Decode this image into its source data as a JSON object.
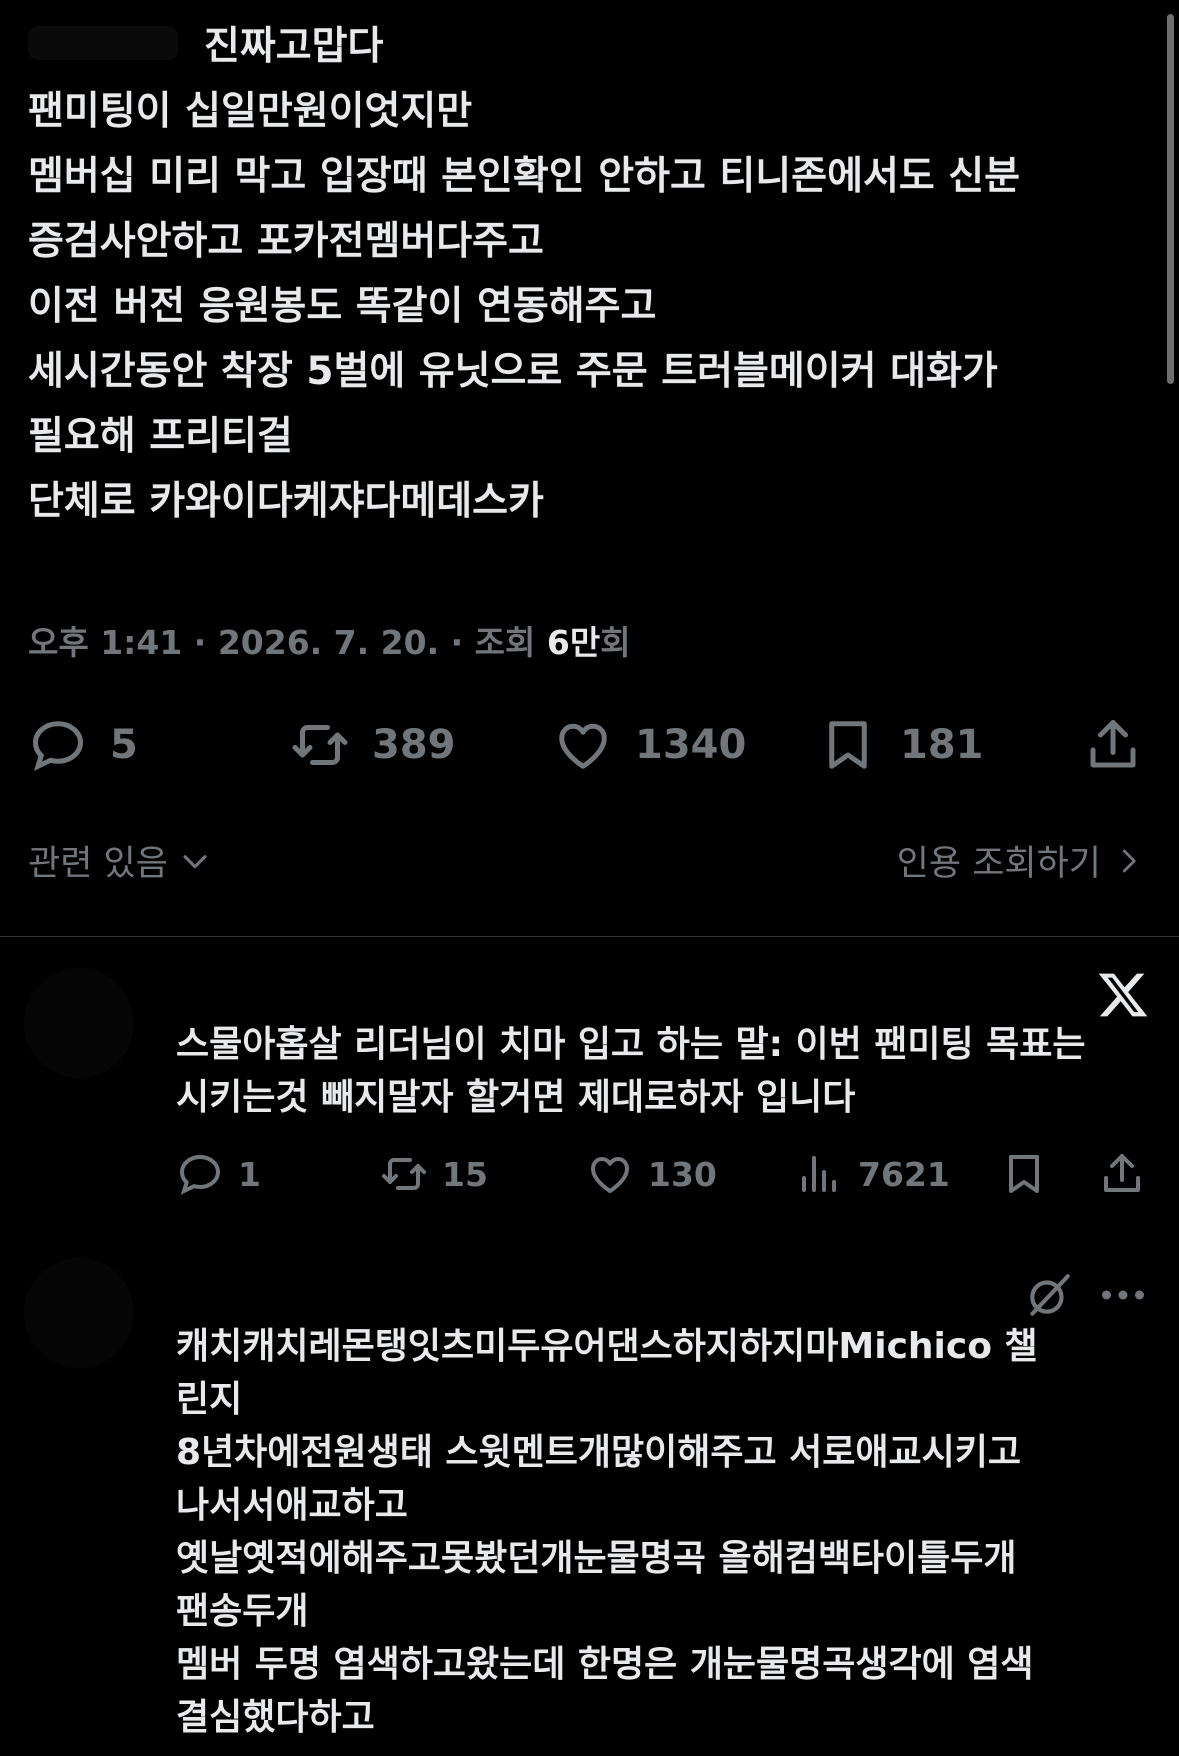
{
  "main_tweet": {
    "lines": [
      "진짜고맙다",
      "팬미팅이 십일만원이엇지만",
      "멤버십 미리 막고 입장때 본인확인 안하고 티니존에서도 신분",
      "증검사안하고 포카전멤버다주고",
      "이전 버전 응원봉도 똑같이 연동해주고",
      "세시간동안 착장 5벌에 유닛으로 주문 트러블메이커 대화가",
      "필요해 프리티걸",
      "단체로 카와이다케쟈다메데스카"
    ],
    "meta": {
      "time": "오후 1:41",
      "sep1": " · ",
      "date": "2026. 7. 20.",
      "sep2": " · ",
      "views_label": "조회 ",
      "views_num": "6만",
      "views_unit": "회"
    },
    "actions": {
      "replies": "5",
      "reposts": "389",
      "likes": "1340",
      "bookmarks": "181"
    },
    "related_label": "관련 있음",
    "quotes_label": "인용 조회하기"
  },
  "replies": [
    {
      "lines": [
        "스물아홉살 리더님이 치마 입고 하는 말: 이번 팬미팅 목표는",
        "시키는것 빼지말자 할거면 제대로하자 입니다"
      ],
      "actions": {
        "replies": "1",
        "reposts": "15",
        "likes": "130",
        "views": "7621"
      }
    },
    {
      "lines": [
        "캐치캐치레몬탱잇츠미두유어댄스하지하지마Michico 챌",
        "린지",
        "8년차에전원생태 스윗멘트개많이해주고 서로애교시키고",
        "나서서애교하고",
        "옛날옛적에해주고못봤던개눈물명곡 올해컴백타이틀두개",
        "팬송두개",
        "멤버 두명 염색하고왔는데 한명은 개눈물명곡생각에 염색",
        "결심했다하고"
      ]
    }
  ],
  "colors": {
    "background": "#000000",
    "text": "#e7e9ea",
    "muted": "#71767b",
    "divider": "#2f3336"
  },
  "icons": [
    "reply-icon",
    "repost-icon",
    "like-icon",
    "bookmark-icon",
    "share-icon",
    "chevron-down-icon",
    "chevron-right-icon",
    "x-logo-icon",
    "views-icon",
    "grok-icon",
    "more-icon"
  ]
}
